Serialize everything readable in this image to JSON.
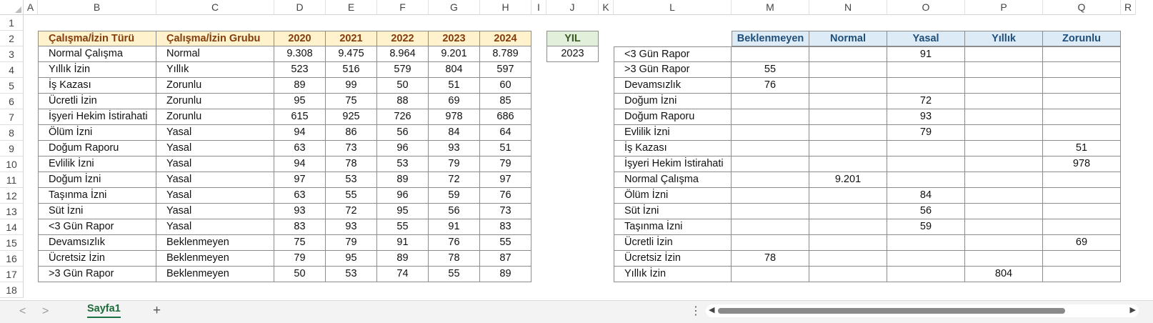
{
  "columns": [
    "A",
    "B",
    "C",
    "D",
    "E",
    "F",
    "G",
    "H",
    "I",
    "J",
    "K",
    "L",
    "M",
    "N",
    "O",
    "P",
    "Q",
    "R"
  ],
  "rows": [
    "1",
    "2",
    "3",
    "4",
    "5",
    "6",
    "7",
    "8",
    "9",
    "10",
    "11",
    "12",
    "13",
    "14",
    "15",
    "16",
    "17",
    "18"
  ],
  "left_table": {
    "headers": [
      "Çalışma/İzin Türü",
      "Çalışma/İzin Grubu",
      "2020",
      "2021",
      "2022",
      "2023",
      "2024"
    ],
    "rows": [
      [
        "Normal Çalışma",
        "Normal",
        "9.308",
        "9.475",
        "8.964",
        "9.201",
        "8.789"
      ],
      [
        "Yıllık İzin",
        "Yıllık",
        "523",
        "516",
        "579",
        "804",
        "597"
      ],
      [
        "İş Kazası",
        "Zorunlu",
        "89",
        "99",
        "50",
        "51",
        "60"
      ],
      [
        "Ücretli İzin",
        "Zorunlu",
        "95",
        "75",
        "88",
        "69",
        "85"
      ],
      [
        "İşyeri Hekim İstirahati",
        "Zorunlu",
        "615",
        "925",
        "726",
        "978",
        "686"
      ],
      [
        "Ölüm İzni",
        "Yasal",
        "94",
        "86",
        "56",
        "84",
        "64"
      ],
      [
        "Doğum Raporu",
        "Yasal",
        "63",
        "73",
        "96",
        "93",
        "51"
      ],
      [
        "Evlilik İzni",
        "Yasal",
        "94",
        "78",
        "53",
        "79",
        "79"
      ],
      [
        "Doğum İzni",
        "Yasal",
        "97",
        "53",
        "89",
        "72",
        "97"
      ],
      [
        "Taşınma İzni",
        "Yasal",
        "63",
        "55",
        "96",
        "59",
        "76"
      ],
      [
        "Süt İzni",
        "Yasal",
        "93",
        "72",
        "95",
        "56",
        "73"
      ],
      [
        "<3 Gün Rapor",
        "Yasal",
        "83",
        "93",
        "55",
        "91",
        "83"
      ],
      [
        "Devamsızlık",
        "Beklenmeyen",
        "75",
        "79",
        "91",
        "76",
        "55"
      ],
      [
        "Ücretsiz İzin",
        "Beklenmeyen",
        "79",
        "95",
        "89",
        "78",
        "87"
      ],
      [
        ">3 Gün Rapor",
        "Beklenmeyen",
        "50",
        "53",
        "74",
        "55",
        "89"
      ]
    ]
  },
  "year_box": {
    "header": "YIL",
    "value": "2023"
  },
  "right_table": {
    "headers": [
      "Beklenmeyen",
      "Normal",
      "Yasal",
      "Yıllık",
      "Zorunlu"
    ],
    "rows": [
      [
        "<3 Gün Rapor",
        "",
        "",
        "91",
        "",
        ""
      ],
      [
        ">3 Gün Rapor",
        "55",
        "",
        "",
        "",
        ""
      ],
      [
        "Devamsızlık",
        "76",
        "",
        "",
        "",
        ""
      ],
      [
        "Doğum İzni",
        "",
        "",
        "72",
        "",
        ""
      ],
      [
        "Doğum Raporu",
        "",
        "",
        "93",
        "",
        ""
      ],
      [
        "Evlilik İzni",
        "",
        "",
        "79",
        "",
        ""
      ],
      [
        "İş Kazası",
        "",
        "",
        "",
        "",
        "51"
      ],
      [
        "İşyeri Hekim İstirahati",
        "",
        "",
        "",
        "",
        "978"
      ],
      [
        "Normal Çalışma",
        "",
        "9.201",
        "",
        "",
        ""
      ],
      [
        "Ölüm İzni",
        "",
        "",
        "84",
        "",
        ""
      ],
      [
        "Süt İzni",
        "",
        "",
        "56",
        "",
        ""
      ],
      [
        "Taşınma İzni",
        "",
        "",
        "59",
        "",
        ""
      ],
      [
        "Ücretli İzin",
        "",
        "",
        "",
        "",
        "69"
      ],
      [
        "Ücretsiz İzin",
        "78",
        "",
        "",
        "",
        ""
      ],
      [
        "Yıllık İzin",
        "",
        "",
        "",
        "804",
        ""
      ]
    ]
  },
  "tabs": {
    "sheet_name": "Sayfa1",
    "add_label": "+",
    "more_label": "⋮",
    "prev_label": "<",
    "next_label": ">"
  },
  "icons": [
    "chevron-left-icon",
    "chevron-right-icon",
    "plus-icon",
    "more-vertical-icon"
  ],
  "colors": {
    "header_yellow": "#fff2cc",
    "header_green": "#e2efda",
    "header_blue": "#ddebf7",
    "tab_green": "#1e7145"
  }
}
